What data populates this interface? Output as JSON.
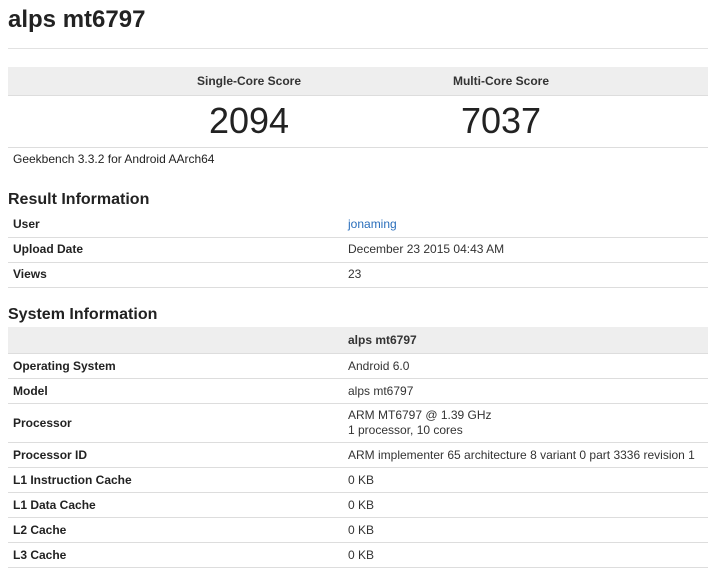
{
  "page": {
    "title": "alps mt6797"
  },
  "scores": {
    "single_core_label": "Single-Core Score",
    "multi_core_label": "Multi-Core Score",
    "single_core_value": "2094",
    "multi_core_value": "7037",
    "version": "Geekbench 3.3.2 for Android AArch64"
  },
  "result_information": {
    "title": "Result Information",
    "rows": [
      {
        "label": "User",
        "value": "jonaming"
      },
      {
        "label": "Upload Date",
        "value": "December 23 2015 04:43 AM"
      },
      {
        "label": "Views",
        "value": "23"
      }
    ]
  },
  "system_information": {
    "title": "System Information",
    "header": "alps mt6797",
    "rows": [
      {
        "label": "Operating System",
        "value": "Android 6.0"
      },
      {
        "label": "Model",
        "value": "alps mt6797"
      },
      {
        "label": "Processor",
        "value": "ARM MT6797 @ 1.39 GHz",
        "value2": "1 processor, 10 cores"
      },
      {
        "label": "Processor ID",
        "value": "ARM implementer 65 architecture 8 variant 0 part 3336 revision 1"
      },
      {
        "label": "L1 Instruction Cache",
        "value": "0 KB"
      },
      {
        "label": "L1 Data Cache",
        "value": "0 KB"
      },
      {
        "label": "L2 Cache",
        "value": "0 KB"
      },
      {
        "label": "L3 Cache",
        "value": "0 KB"
      }
    ]
  },
  "colors": {
    "link": "#2a6ebb",
    "header_bg": "#eeeeee",
    "row_border": "#dddddd"
  }
}
